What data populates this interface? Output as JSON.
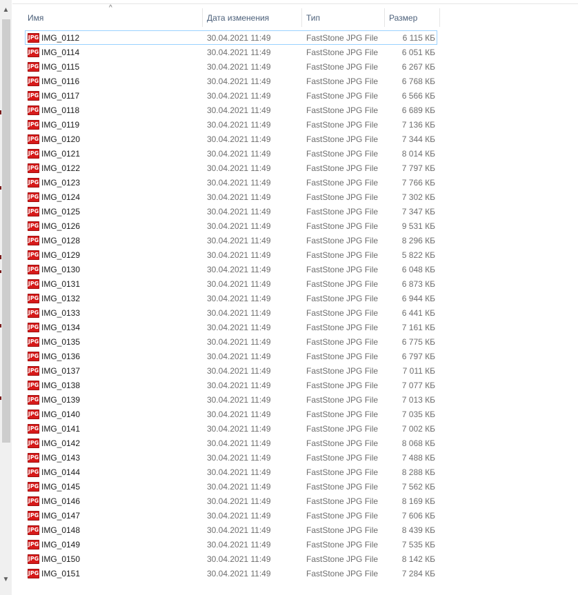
{
  "header": {
    "name": "Имя",
    "date": "Дата изменения",
    "type": "Тип",
    "size": "Размер",
    "sort_icon": "sort-ascending-icon"
  },
  "icons": {
    "file_icon": "jpg-file-icon",
    "file_icon_label": "JPG",
    "file_icon_color": "#d61a1a",
    "scroll_up": "▲",
    "scroll_down": "▼"
  },
  "colors": {
    "focus_border": "#99d1ff",
    "header_text": "#4c607a"
  },
  "files": [
    {
      "name": "IMG_0112",
      "date": "30.04.2021 11:49",
      "type": "FastStone JPG File",
      "size": "6 115 КБ"
    },
    {
      "name": "IMG_0114",
      "date": "30.04.2021 11:49",
      "type": "FastStone JPG File",
      "size": "6 051 КБ"
    },
    {
      "name": "IMG_0115",
      "date": "30.04.2021 11:49",
      "type": "FastStone JPG File",
      "size": "6 267 КБ"
    },
    {
      "name": "IMG_0116",
      "date": "30.04.2021 11:49",
      "type": "FastStone JPG File",
      "size": "6 768 КБ"
    },
    {
      "name": "IMG_0117",
      "date": "30.04.2021 11:49",
      "type": "FastStone JPG File",
      "size": "6 566 КБ"
    },
    {
      "name": "IMG_0118",
      "date": "30.04.2021 11:49",
      "type": "FastStone JPG File",
      "size": "6 689 КБ"
    },
    {
      "name": "IMG_0119",
      "date": "30.04.2021 11:49",
      "type": "FastStone JPG File",
      "size": "7 136 КБ"
    },
    {
      "name": "IMG_0120",
      "date": "30.04.2021 11:49",
      "type": "FastStone JPG File",
      "size": "7 344 КБ"
    },
    {
      "name": "IMG_0121",
      "date": "30.04.2021 11:49",
      "type": "FastStone JPG File",
      "size": "8 014 КБ"
    },
    {
      "name": "IMG_0122",
      "date": "30.04.2021 11:49",
      "type": "FastStone JPG File",
      "size": "7 797 КБ"
    },
    {
      "name": "IMG_0123",
      "date": "30.04.2021 11:49",
      "type": "FastStone JPG File",
      "size": "7 766 КБ"
    },
    {
      "name": "IMG_0124",
      "date": "30.04.2021 11:49",
      "type": "FastStone JPG File",
      "size": "7 302 КБ"
    },
    {
      "name": "IMG_0125",
      "date": "30.04.2021 11:49",
      "type": "FastStone JPG File",
      "size": "7 347 КБ"
    },
    {
      "name": "IMG_0126",
      "date": "30.04.2021 11:49",
      "type": "FastStone JPG File",
      "size": "9 531 КБ"
    },
    {
      "name": "IMG_0128",
      "date": "30.04.2021 11:49",
      "type": "FastStone JPG File",
      "size": "8 296 КБ"
    },
    {
      "name": "IMG_0129",
      "date": "30.04.2021 11:49",
      "type": "FastStone JPG File",
      "size": "5 822 КБ"
    },
    {
      "name": "IMG_0130",
      "date": "30.04.2021 11:49",
      "type": "FastStone JPG File",
      "size": "6 048 КБ"
    },
    {
      "name": "IMG_0131",
      "date": "30.04.2021 11:49",
      "type": "FastStone JPG File",
      "size": "6 873 КБ"
    },
    {
      "name": "IMG_0132",
      "date": "30.04.2021 11:49",
      "type": "FastStone JPG File",
      "size": "6 944 КБ"
    },
    {
      "name": "IMG_0133",
      "date": "30.04.2021 11:49",
      "type": "FastStone JPG File",
      "size": "6 441 КБ"
    },
    {
      "name": "IMG_0134",
      "date": "30.04.2021 11:49",
      "type": "FastStone JPG File",
      "size": "7 161 КБ"
    },
    {
      "name": "IMG_0135",
      "date": "30.04.2021 11:49",
      "type": "FastStone JPG File",
      "size": "6 775 КБ"
    },
    {
      "name": "IMG_0136",
      "date": "30.04.2021 11:49",
      "type": "FastStone JPG File",
      "size": "6 797 КБ"
    },
    {
      "name": "IMG_0137",
      "date": "30.04.2021 11:49",
      "type": "FastStone JPG File",
      "size": "7 011 КБ"
    },
    {
      "name": "IMG_0138",
      "date": "30.04.2021 11:49",
      "type": "FastStone JPG File",
      "size": "7 077 КБ"
    },
    {
      "name": "IMG_0139",
      "date": "30.04.2021 11:49",
      "type": "FastStone JPG File",
      "size": "7 013 КБ"
    },
    {
      "name": "IMG_0140",
      "date": "30.04.2021 11:49",
      "type": "FastStone JPG File",
      "size": "7 035 КБ"
    },
    {
      "name": "IMG_0141",
      "date": "30.04.2021 11:49",
      "type": "FastStone JPG File",
      "size": "7 002 КБ"
    },
    {
      "name": "IMG_0142",
      "date": "30.04.2021 11:49",
      "type": "FastStone JPG File",
      "size": "8 068 КБ"
    },
    {
      "name": "IMG_0143",
      "date": "30.04.2021 11:49",
      "type": "FastStone JPG File",
      "size": "7 488 КБ"
    },
    {
      "name": "IMG_0144",
      "date": "30.04.2021 11:49",
      "type": "FastStone JPG File",
      "size": "8 288 КБ"
    },
    {
      "name": "IMG_0145",
      "date": "30.04.2021 11:49",
      "type": "FastStone JPG File",
      "size": "7 562 КБ"
    },
    {
      "name": "IMG_0146",
      "date": "30.04.2021 11:49",
      "type": "FastStone JPG File",
      "size": "8 169 КБ"
    },
    {
      "name": "IMG_0147",
      "date": "30.04.2021 11:49",
      "type": "FastStone JPG File",
      "size": "7 606 КБ"
    },
    {
      "name": "IMG_0148",
      "date": "30.04.2021 11:49",
      "type": "FastStone JPG File",
      "size": "8 439 КБ"
    },
    {
      "name": "IMG_0149",
      "date": "30.04.2021 11:49",
      "type": "FastStone JPG File",
      "size": "7 535 КБ"
    },
    {
      "name": "IMG_0150",
      "date": "30.04.2021 11:49",
      "type": "FastStone JPG File",
      "size": "8 142 КБ"
    },
    {
      "name": "IMG_0151",
      "date": "30.04.2021 11:49",
      "type": "FastStone JPG File",
      "size": "7 284 КБ"
    }
  ]
}
